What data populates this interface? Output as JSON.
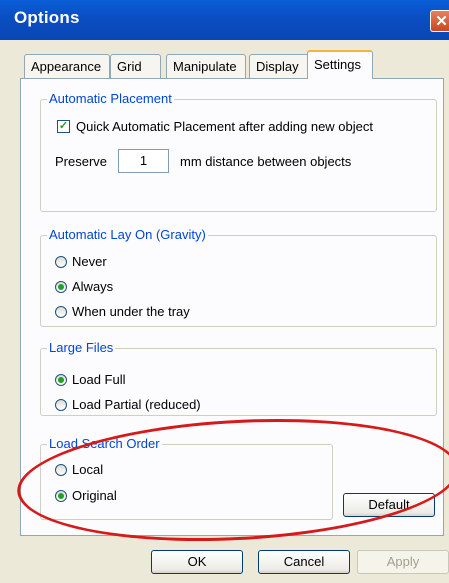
{
  "window": {
    "title": "Options",
    "close_icon": "close-icon"
  },
  "tabs": [
    {
      "label": "Appearance",
      "active": false
    },
    {
      "label": "Grid",
      "active": false
    },
    {
      "label": "Manipulate",
      "active": false
    },
    {
      "label": "Display",
      "active": false
    },
    {
      "label": "Settings",
      "active": true
    }
  ],
  "automatic_placement": {
    "legend": "Automatic Placement",
    "checkbox_label": "Quick Automatic Placement after adding new object",
    "checked": true,
    "preserve_label": "Preserve",
    "preserve_value": "1",
    "unit_label": "mm distance between objects"
  },
  "gravity": {
    "legend": "Automatic Lay On (Gravity)",
    "options": [
      "Never",
      "Always",
      "When under the tray"
    ],
    "selected": "Always"
  },
  "large_files": {
    "legend": "Large Files",
    "options": [
      "Load Full",
      "Load Partial (reduced)"
    ],
    "selected": "Load Full"
  },
  "search_order": {
    "legend": "Load Search Order",
    "options": [
      "Local",
      "Original"
    ],
    "selected": "Original",
    "default_button": "Default"
  },
  "footer": {
    "ok": "OK",
    "cancel": "Cancel",
    "apply": "Apply"
  },
  "colors": {
    "title_bar": "#0846b4",
    "legend_text": "#0046d5",
    "annotation": "#d61a1a"
  }
}
